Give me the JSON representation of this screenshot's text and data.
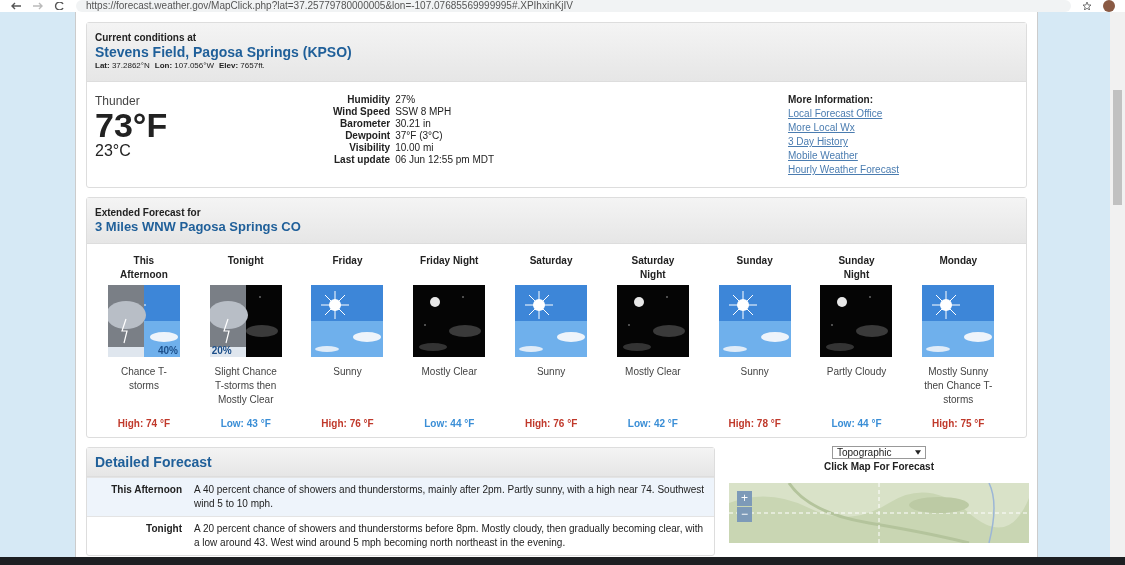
{
  "browser": {
    "url": "https://forecast.weather.gov/MapClick.php?lat=37.25779780000005&lon=-107.07685569999995#.XPIhxinKjIV"
  },
  "current": {
    "heading": "Current conditions at",
    "station": "Stevens Field, Pagosa Springs (KPSO)",
    "coords": [
      {
        "label": "Lat:",
        "value": "37.2862°N"
      },
      {
        "label": "Lon:",
        "value": "107.056°W"
      },
      {
        "label": "Elev:",
        "value": "7657ft."
      }
    ],
    "condition": "Thunder",
    "temp_f": "73°F",
    "temp_c": "23°C",
    "details": [
      {
        "label": "Humidity",
        "value": "27%"
      },
      {
        "label": "Wind Speed",
        "value": "SSW 8 MPH"
      },
      {
        "label": "Barometer",
        "value": "30.21 in"
      },
      {
        "label": "Dewpoint",
        "value": "37°F (3°C)"
      },
      {
        "label": "Visibility",
        "value": "10.00 mi"
      },
      {
        "label": "Last update",
        "value": "06 Jun 12:55 pm MDT"
      }
    ],
    "more_info": {
      "heading": "More Information:",
      "links": [
        "Local Forecast Office",
        "More Local Wx",
        "3 Day History",
        "Mobile Weather",
        "Hourly Weather Forecast"
      ]
    }
  },
  "extended": {
    "heading": "Extended Forecast for",
    "location": "3 Miles WNW Pagosa Springs CO",
    "periods": [
      {
        "name": "This Afternoon",
        "pop": "40%",
        "summary": "Chance T-storms",
        "temp": "High: 74 °F",
        "kind": "high"
      },
      {
        "name": "Tonight",
        "pop": "20%",
        "summary": "Slight Chance T-storms then Mostly Clear",
        "temp": "Low: 43 °F",
        "kind": "low"
      },
      {
        "name": "Friday",
        "summary": "Sunny",
        "temp": "High: 76 °F",
        "kind": "high"
      },
      {
        "name": "Friday Night",
        "summary": "Mostly Clear",
        "temp": "Low: 44 °F",
        "kind": "low"
      },
      {
        "name": "Saturday",
        "summary": "Sunny",
        "temp": "High: 76 °F",
        "kind": "high"
      },
      {
        "name": "Saturday Night",
        "summary": "Mostly Clear",
        "temp": "Low: 42 °F",
        "kind": "low"
      },
      {
        "name": "Sunday",
        "summary": "Sunny",
        "temp": "High: 78 °F",
        "kind": "high"
      },
      {
        "name": "Sunday Night",
        "summary": "Partly Cloudy",
        "temp": "Low: 44 °F",
        "kind": "low"
      },
      {
        "name": "Monday",
        "summary": "Mostly Sunny then Chance T-storms",
        "temp": "High: 75 °F",
        "kind": "high"
      }
    ]
  },
  "detailed": {
    "heading": "Detailed Forecast",
    "rows": [
      {
        "period": "This Afternoon",
        "text": "A 40 percent chance of showers and thunderstorms, mainly after 2pm. Partly sunny, with a high near 74. Southwest wind 5 to 10 mph.",
        "selected": true
      },
      {
        "period": "Tonight",
        "text": "A 20 percent chance of showers and thunderstorms before 8pm. Mostly cloudy, then gradually becoming clear, with a low around 43. West wind around 5 mph becoming north northeast in the evening.",
        "selected": false
      }
    ]
  },
  "map": {
    "layer": "Topographic",
    "caption": "Click Map For Forecast",
    "zoom_in": "+",
    "zoom_out": "−"
  }
}
